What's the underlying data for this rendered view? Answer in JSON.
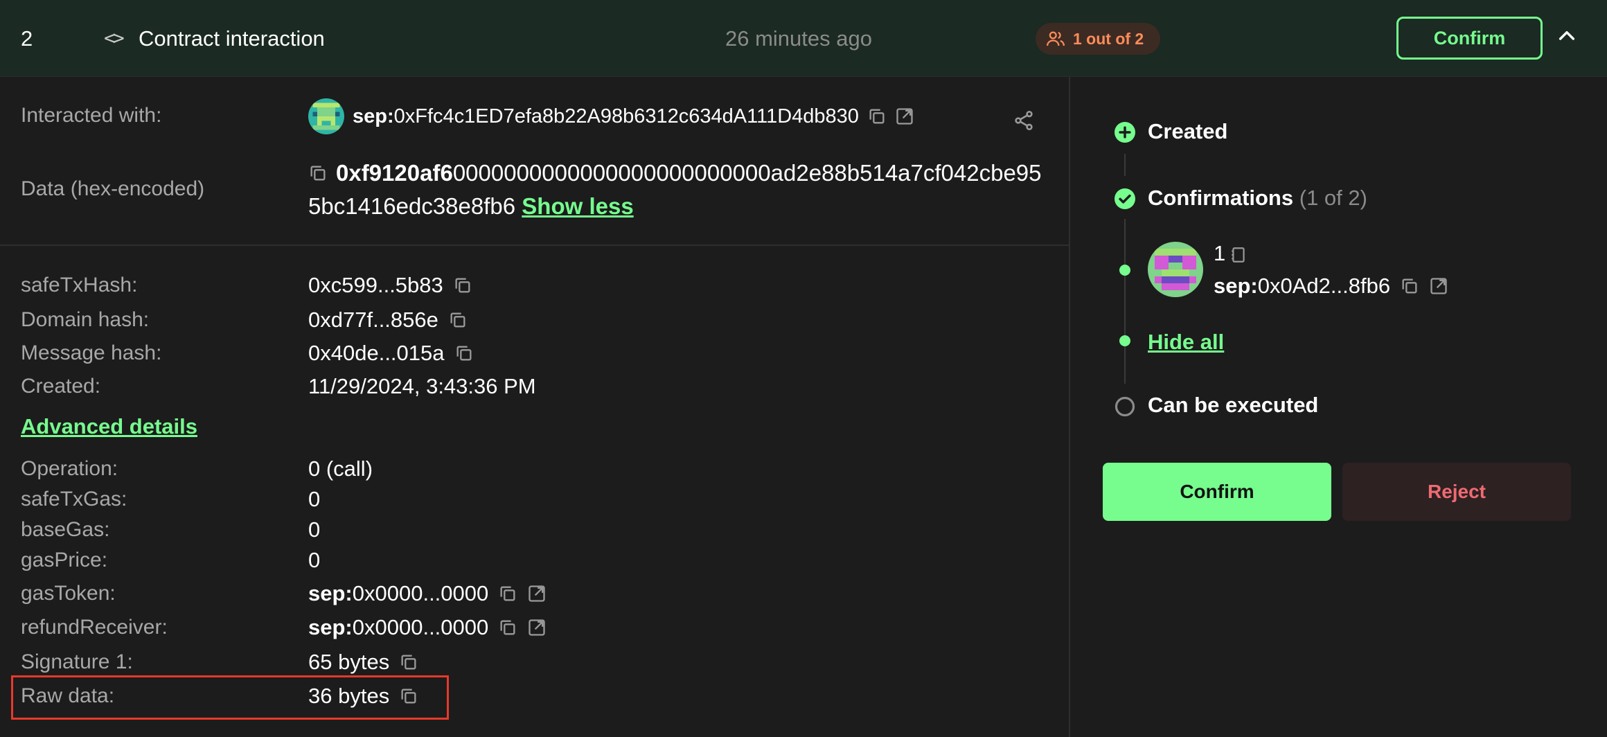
{
  "header": {
    "index": "2",
    "type_icon": "code-icon",
    "type_label": "Contract interaction",
    "time": "26 minutes ago",
    "confirmations_badge": "1 out of 2",
    "confirm_label": "Confirm"
  },
  "details": {
    "interacted_with_label": "Interacted with:",
    "interacted_with_prefix": "sep:",
    "interacted_with_address": "0xFfc4c1ED7efa8b22A98b6312c634dA111D4db830",
    "data_label": "Data (hex-encoded)",
    "data_selector": "0xf9120af6",
    "data_rest": "0000000000000000000000000ad2e88b514a7cf042cbe955bc1416edc38e8fb6",
    "show_less": "Show less"
  },
  "hashes": [
    {
      "label": "safeTxHash:",
      "value": "0xc599...5b83"
    },
    {
      "label": "Domain hash:",
      "value": "0xd77f...856e"
    },
    {
      "label": "Message hash:",
      "value": "0x40de...015a"
    },
    {
      "label": "Created:",
      "value": "11/29/2024, 3:43:36 PM"
    }
  ],
  "advanced_details_label": "Advanced details",
  "advanced": {
    "operation_label": "Operation:",
    "operation_value": "0 (call)",
    "safe_tx_gas_label": "safeTxGas:",
    "safe_tx_gas_value": "0",
    "base_gas_label": "baseGas:",
    "base_gas_value": "0",
    "gas_price_label": "gasPrice:",
    "gas_price_value": "0",
    "gas_token_label": "gasToken:",
    "gas_token_prefix": "sep:",
    "gas_token_value": "0x0000...0000",
    "refund_receiver_label": "refundReceiver:",
    "refund_receiver_prefix": "sep:",
    "refund_receiver_value": "0x0000...0000",
    "signature_label": "Signature 1:",
    "signature_value": "65 bytes",
    "raw_data_label": "Raw data:",
    "raw_data_value": "36 bytes"
  },
  "timeline": {
    "created": "Created",
    "confirmations": "Confirmations",
    "confirmations_count": "(1 of 2)",
    "signer_index": "1",
    "signer_prefix": "sep:",
    "signer_address": "0x0Ad2...8fb6",
    "hide_all": "Hide all",
    "can_be_executed": "Can be executed"
  },
  "actions": {
    "confirm": "Confirm",
    "reject": "Reject"
  },
  "colors": {
    "accent": "#76fd8e",
    "badge_text": "#ff8c5a",
    "reject_text": "#f06a72",
    "highlight": "#e8392a"
  }
}
